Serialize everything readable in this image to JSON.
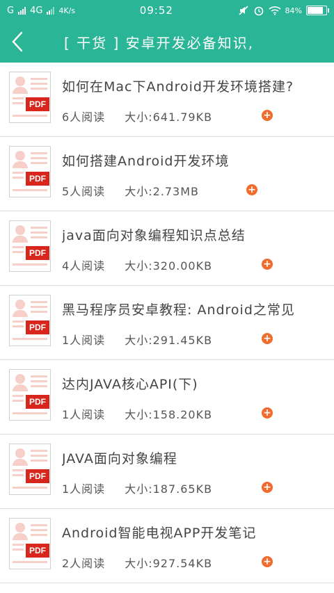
{
  "status": {
    "carrier1": "G",
    "carrier2": "4G",
    "speed": "4K/s",
    "time": "09:52",
    "battery": "84%",
    "battery_level": 0.84
  },
  "header": {
    "title": "[ 干货 ] 安卓开发必备知识,"
  },
  "list": {
    "size_prefix": "大小:",
    "items": [
      {
        "name": "如何在Mac下Android开发环境搭建?",
        "readers": "6人阅读",
        "size": "641.79KB"
      },
      {
        "name": "如何搭建Android开发环境",
        "readers": "5人阅读",
        "size": "2.73MB"
      },
      {
        "name": "java面向对象编程知识点总结",
        "readers": "4人阅读",
        "size": "320.00KB"
      },
      {
        "name": "黑马程序员安卓教程: Android之常见",
        "readers": "1人阅读",
        "size": "291.45KB"
      },
      {
        "name": "达内JAVA核心API(下)",
        "readers": "1人阅读",
        "size": "158.20KB"
      },
      {
        "name": "JAVA面向对象编程",
        "readers": "1人阅读",
        "size": "187.65KB"
      },
      {
        "name": "Android智能电视APP开发笔记",
        "readers": "2人阅读",
        "size": "927.54KB"
      }
    ],
    "badge": "PDF",
    "add_glyph": "+"
  },
  "colors": {
    "accent": "#2bb597",
    "pdf_red": "#d9261c",
    "add_orange": "#f26b2d"
  }
}
